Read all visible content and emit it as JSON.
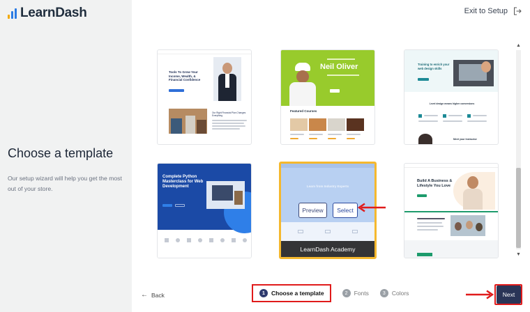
{
  "brand": {
    "name": "LearnDash"
  },
  "header": {
    "exit_label": "Exit to Setup"
  },
  "left_panel": {
    "title": "Choose a template",
    "description": "Our setup wizard will help you get the most out of your store."
  },
  "templates": [
    {
      "headline": "Tools To Grow Your Income, Wealth, & Financial Confidence",
      "subhead": "Our Right Financial Plan Changes Everything"
    },
    {
      "headline": "Neil Oliver",
      "section": "Featured Courses"
    },
    {
      "headline": "Training to enrich your web design skills",
      "subhead": "Level design means higher conversions",
      "footer_text": "Meet your Instructor"
    },
    {
      "headline": "Complete Python Masterclass for Web Development"
    },
    {
      "headline": "Learn from Industry Experts",
      "name": "LearnDash Academy",
      "preview_label": "Preview",
      "select_label": "Select",
      "selected": true
    },
    {
      "headline": "Build A Business & Lifestyle You Love"
    }
  ],
  "footer": {
    "back_label": "Back",
    "steps": [
      {
        "num": "1",
        "label": "Choose a template",
        "active": true
      },
      {
        "num": "2",
        "label": "Fonts",
        "active": false
      },
      {
        "num": "3",
        "label": "Colors",
        "active": false
      }
    ],
    "next_label": "Next"
  },
  "colors": {
    "accent_navy": "#2a3557",
    "highlight_red": "#e01b1b",
    "selected_border": "#f5b82e",
    "left_panel_bg": "#f1f2f2"
  }
}
